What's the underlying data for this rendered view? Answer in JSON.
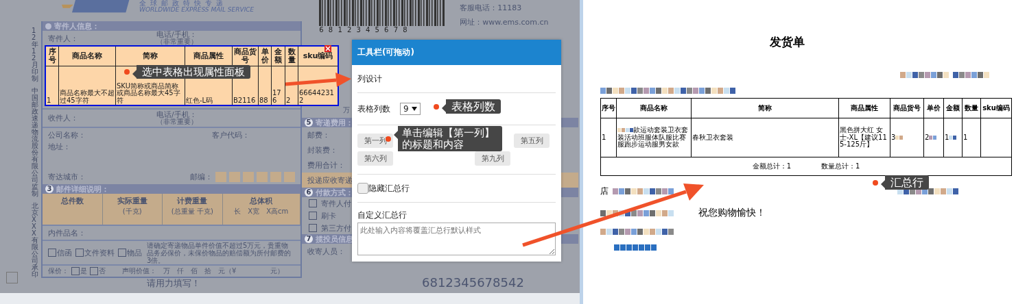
{
  "ems_form": {
    "tagline": "全球邮政特快专递",
    "subtitle": "WORLDWIDE EXPRESS MAIL SERVICE",
    "barcode_digits": "6 8 1 2 3 4 5 6 7 8",
    "service_phone": "客服电话：11183",
    "website": "网址：www.ems.com.cn",
    "side_texts": [
      "12年12月印制",
      "中国邮政速递物流股份有限公司监制",
      "北京XXX有限公司承印"
    ],
    "sender_section": "寄件人信息：",
    "sender_label": "寄件人：",
    "phone_label": "电话/手机：",
    "phone_note": "（非常重要）",
    "receiver_label": "收件人：",
    "receiver_phone_label": "电话/手机：",
    "receiver_phone_note": "（非常重要）",
    "company_label": "公司名称：",
    "customer_code_label": "客户代码：",
    "address_label": "地址：",
    "city_label": "寄达城市：",
    "zip_label": "邮编：",
    "detail_section": "邮件详细说明：",
    "corner_checkbox": {
      "checked": false
    },
    "detail_columns": [
      {
        "label": "总件数"
      },
      {
        "label": "实际重量",
        "unit": "(千克)"
      },
      {
        "label": "计费重量",
        "unit": "(总重量 千克)"
      },
      {
        "label": "总体积",
        "unit": "长　X宽　X高cm"
      }
    ],
    "contents_label": "内件品名：",
    "item_types": [
      {
        "label": "信函",
        "checked": false
      },
      {
        "label": "文件资料",
        "checked": false
      },
      {
        "label": "物品",
        "checked": false
      }
    ],
    "notice": "请确定寄递物品单件价值不超过5万元，贵重物品务必保价，未保价物品的赔偿额为所付邮费的3倍。",
    "insured_label": "保价：",
    "insured_options": [
      {
        "label": "是",
        "checked": false
      },
      {
        "label": "否",
        "checked": false
      }
    ],
    "declared_value": "声明价值：　万　仟　佰　拾　元（¥　　　　　元）",
    "footer": "请用力填写！",
    "tracking_number": "6812345678542",
    "peek_text": "万",
    "fee_section": "寄递费用：",
    "fee_rows": [
      "邮费：",
      "封装费：",
      "费用合计："
    ],
    "cod_label": "投递应收寄递",
    "payment_section": "付款方式：",
    "payment_options": [
      {
        "label": "寄件人付",
        "checked": false
      },
      {
        "label": "刷卡",
        "checked": false
      },
      {
        "label": "第三方付",
        "checked": false
      }
    ],
    "courier_section": "揽投员信息",
    "courier_label": "收寄人员：",
    "fee_number": "5",
    "payment_number": "6",
    "detail_number": "3",
    "courier_number": "7"
  },
  "selected_table": {
    "columns": [
      "序号",
      "商品名称",
      "简称",
      "商品属性",
      "商品货号",
      "单价",
      "金额",
      "数量",
      "sku编码"
    ],
    "row": [
      "1",
      "商品名称最大不超过45字符",
      "SKU简称或商品简称或商品名称最大45字符",
      "红色-L码",
      "B2116",
      "88",
      "176",
      "2",
      "666442312"
    ]
  },
  "toolbar": {
    "title": "工具栏(可拖动)",
    "section": "列设计",
    "column_count_label": "表格列数",
    "column_count": "9",
    "column_buttons": [
      {
        "label": "第一列"
      },
      {
        "label": "第五列"
      },
      {
        "label": "第六列"
      },
      {
        "label": "第九列"
      }
    ],
    "hide_summary": {
      "label": "隐藏汇总行",
      "checked": false
    },
    "custom_summary_label": "自定义汇总行",
    "custom_summary_placeholder": "此处输入内容将覆盖汇总行默认样式"
  },
  "callouts": [
    "选中表格出现属性面板",
    "表格列数",
    "单击编辑【第一列】的标题和内容",
    "汇总行"
  ],
  "invoice": {
    "title": "发货单",
    "columns": [
      "序号",
      "商品名称",
      "简称",
      "商品属性",
      "商品货号",
      "单价",
      "金额",
      "数量",
      "sku编码"
    ],
    "row": [
      "1",
      "款运动套装卫衣套装活动班服体队服比赛服跑步运动服男女款",
      "春秋卫衣套装",
      "黑色拼大红 女士-XL【建议115-125斤】",
      "3",
      "2",
      "1",
      "1"
    ],
    "summary": [
      "金额总计：1",
      "数量总计：1"
    ],
    "shop_prefix": "店",
    "greeting": "祝您购物愉快！"
  }
}
